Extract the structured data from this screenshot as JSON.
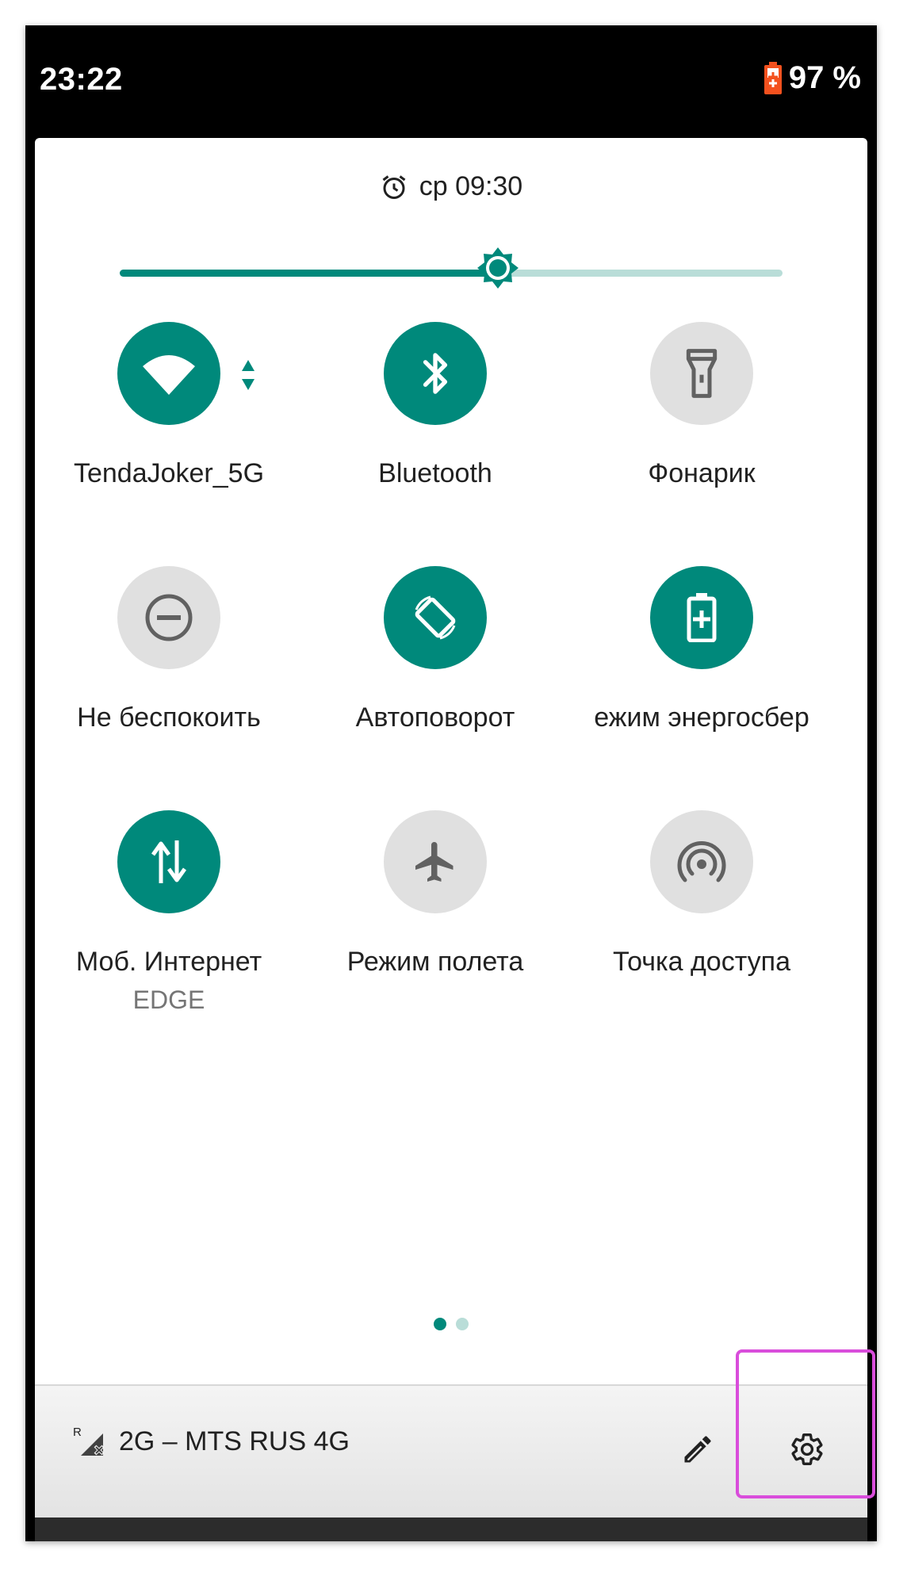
{
  "statusbar": {
    "time": "23:22",
    "battery_percent": "97 %"
  },
  "alarm": {
    "text": "ср 09:30",
    "icon": "alarm-clock-icon"
  },
  "brightness": {
    "level": 0.57
  },
  "tiles": [
    {
      "label": "TendaJoker_5G",
      "state": "on",
      "icon": "wifi-icon"
    },
    {
      "label": "Bluetooth",
      "state": "on",
      "icon": "bluetooth-icon"
    },
    {
      "label": "Фонарик",
      "state": "off",
      "icon": "flashlight-icon"
    },
    {
      "label": "Не беспокоить",
      "state": "off",
      "icon": "do-not-disturb-icon"
    },
    {
      "label": "Автоповорот",
      "state": "on",
      "icon": "auto-rotate-icon"
    },
    {
      "label": "Режим энергосбережения",
      "label_visible": "ежим энергосбер",
      "state": "on",
      "icon": "battery-saver-icon"
    },
    {
      "label": "Моб. Интернет",
      "sublabel": "EDGE",
      "state": "on",
      "icon": "mobile-data-icon"
    },
    {
      "label": "Режим полета",
      "state": "off",
      "icon": "airplane-icon"
    },
    {
      "label": "Точка доступа",
      "state": "off",
      "icon": "hotspot-icon"
    }
  ],
  "pager": {
    "current_page": 1,
    "total_pages": 2
  },
  "footer": {
    "carrier_text": "2G – MTS RUS 4G",
    "roaming_indicator": "R"
  },
  "colors": {
    "accent": "#00897b",
    "accent_light": "#b9ddd8",
    "off_tile": "#e0e0e0",
    "battery_icon": "#f4511e",
    "highlight": "#d94ddb"
  }
}
